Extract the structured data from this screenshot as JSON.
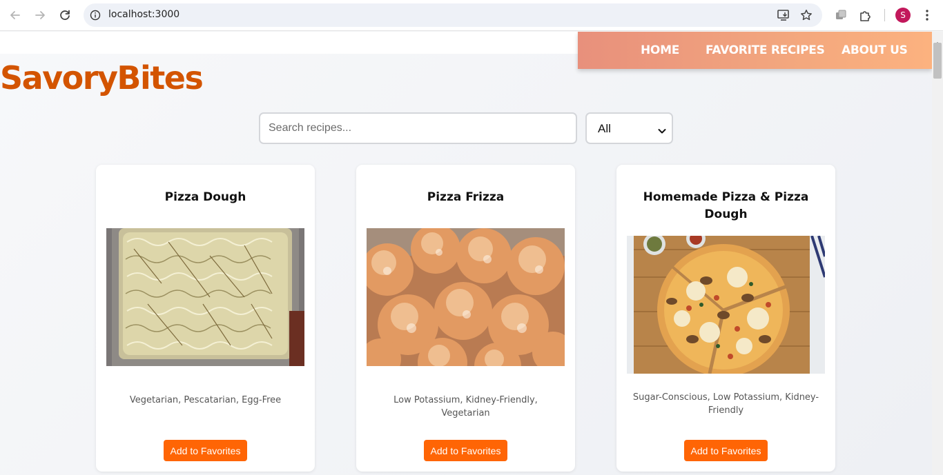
{
  "browser": {
    "url": "localhost:3000",
    "profile_initial": "S",
    "profile_color": "#c2185b"
  },
  "site": {
    "brand": "SavoryBites",
    "brand_color": "#d35400",
    "nav": [
      "HOME",
      "FAVORITE RECIPES",
      "ABOUT US"
    ]
  },
  "search": {
    "placeholder": "Search recipes...",
    "value": ""
  },
  "filter": {
    "selected": "All"
  },
  "recipes": [
    {
      "title": "Pizza Dough",
      "tags": "Vegetarian, Pescatarian, Egg-Free",
      "image": "pizza-dough-photo",
      "button": "Add to Favorites"
    },
    {
      "title": "Pizza Frizza",
      "tags": "Low Potassium, Kidney-Friendly, Vegetarian",
      "image": "pizza-frizza-photo",
      "button": "Add to Favorites"
    },
    {
      "title": "Homemade Pizza & Pizza Dough",
      "tags": "Sugar-Conscious, Low Potassium, Kidney-Friendly",
      "image": "homemade-pizza-photo",
      "button": "Add to Favorites"
    }
  ],
  "colors": {
    "accent_button": "#ff6505",
    "navbar_start": "#e8907c",
    "navbar_end": "#fcb27f"
  }
}
